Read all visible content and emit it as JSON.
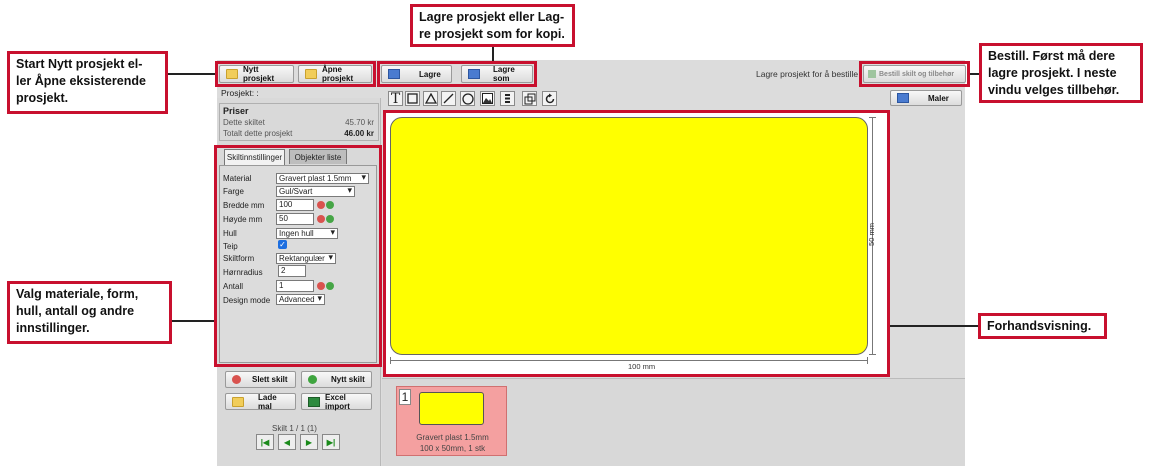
{
  "toolbar": {
    "new_project": "Nytt prosjekt",
    "open_project": "Åpne prosjekt",
    "save": "Lagre",
    "save_as": "Lagre som",
    "save_hint": "Lagre prosjekt for å bestille",
    "order": "Bestill skilt og tilbehør",
    "templates": "Maler"
  },
  "project": {
    "label": "Prosjekt: :",
    "prices_title": "Priser",
    "this_sign_label": "Dette skiltet",
    "this_sign_value": "45.70 kr",
    "total_label": "Totalt dette prosjekt",
    "total_value": "46.00 kr"
  },
  "tabs": {
    "settings": "Skiltinnstillinger",
    "objects": "Objekter liste"
  },
  "settings": {
    "material_label": "Material",
    "material_value": "Gravert plast 1.5mm",
    "color_label": "Farge",
    "color_value": "Gul/Svart",
    "width_label": "Bredde mm",
    "width_value": "100",
    "height_label": "Høyde mm",
    "height_value": "50",
    "hole_label": "Hull",
    "hole_value": "Ingen hull",
    "tape_label": "Teip",
    "shape_label": "Skiltform",
    "shape_value": "Rektangulær",
    "radius_label": "Hørnradius",
    "radius_value": "2",
    "count_label": "Antall",
    "count_value": "1",
    "mode_label": "Design mode",
    "mode_value": "Advanced"
  },
  "actions": {
    "delete": "Slett skilt",
    "new": "Nytt skilt",
    "load_template": "Lade mal",
    "excel": "Excel import"
  },
  "pager": {
    "text": "Skilt 1 / 1 (1)"
  },
  "canvas": {
    "width_label": "100 mm",
    "height_label": "50 mm",
    "sign_color": "#ffff00"
  },
  "thumbnail": {
    "number": "1",
    "material": "Gravert plast 1.5mm",
    "details": "100 x 50mm, 1 stk"
  },
  "callouts": {
    "new_open": "Start Nytt prosjekt el-\nler Åpne eksisterende\nprosjekt.",
    "save": "Lagre prosjekt eller Lag-\nre prosjekt som for kopi.",
    "order": "Bestill. Først må dere\nlagre prosjekt. I neste\nvindu velges tillbehør.",
    "settings": "Valg materiale, form,\nhull, antall og andre\ninnstillinger.",
    "preview": "Forhandsvisning."
  },
  "colors": {
    "accent": "#c8102e",
    "sign": "#ffff00",
    "thumb_bg": "#f4a0a0"
  }
}
